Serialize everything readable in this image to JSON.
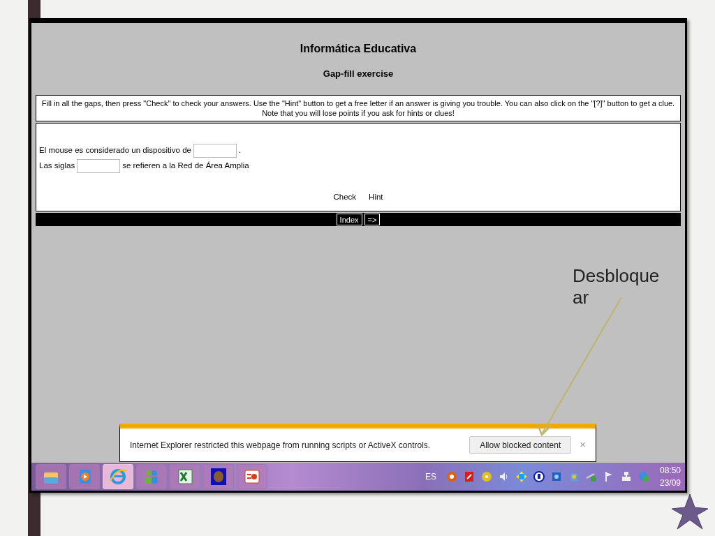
{
  "browser": {
    "page_title": "Informática Educativa",
    "exercise_title": "Gap-fill exercise",
    "instructions": "Fill in all the gaps, then press \"Check\" to check your answers. Use the \"Hint\" button to get a free letter if an answer is giving you trouble. You can also click on the \"[?]\" button to get a clue. Note that you will lose points if you ask for hints or clues!",
    "questions": [
      {
        "before": "El mouse es considerado un dispositivo de",
        "after": "."
      },
      {
        "before": "Las siglas",
        "after": "se refieren a la Red de Área Amplia"
      }
    ],
    "buttons": [
      "Check",
      "Hint"
    ],
    "nav_buttons": [
      "Index",
      "=>"
    ]
  },
  "notification": {
    "message": "Internet Explorer restricted this webpage from running scripts or ActiveX controls.",
    "button": "Allow blocked content",
    "close": "×"
  },
  "taskbar": {
    "apps": [
      {
        "kind": "folder",
        "selected": false
      },
      {
        "kind": "media",
        "selected": false
      },
      {
        "kind": "browser",
        "selected": true
      },
      {
        "kind": "people",
        "selected": false
      },
      {
        "kind": "spreadsheet",
        "selected": false
      },
      {
        "kind": "hand",
        "selected": false
      },
      {
        "kind": "presentation",
        "selected": false
      }
    ],
    "language": "ES",
    "time": "08:50",
    "date": "23/09"
  },
  "callout": {
    "text": "Desbloquear"
  }
}
